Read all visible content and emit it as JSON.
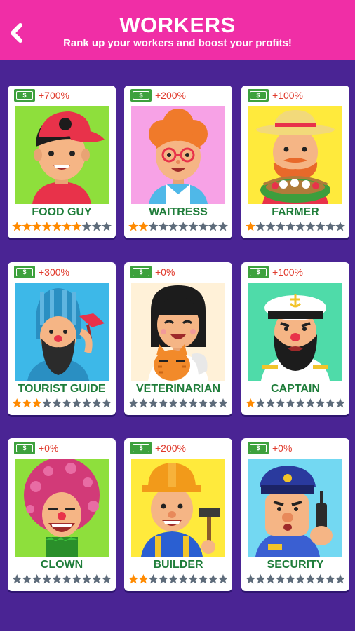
{
  "header": {
    "title": "WORKERS",
    "subtitle": "Rank up your workers and boost your profits!",
    "back_icon": "chevron-left-icon"
  },
  "money_badge": {
    "symbol": "$",
    "icon": "money-icon",
    "color": "#3da13d"
  },
  "colors": {
    "header": "#f02ea6",
    "background": "#4a2494",
    "star_filled": "#ff8a00",
    "star_empty": "#5d6b7a",
    "boost_text": "#e03a2c",
    "name_text": "#1f7d3a"
  },
  "workers": [
    {
      "name": "FOOD GUY",
      "boost": "+700%",
      "stars": 7,
      "max_stars": 10,
      "portrait_bg": "#8edf3c"
    },
    {
      "name": "WAITRESS",
      "boost": "+200%",
      "stars": 2,
      "max_stars": 10,
      "portrait_bg": "#f7a2e6"
    },
    {
      "name": "FARMER",
      "boost": "+100%",
      "stars": 1,
      "max_stars": 10,
      "portrait_bg": "#ffea3c"
    },
    {
      "name": "TOURIST GUIDE",
      "boost": "+300%",
      "stars": 3,
      "max_stars": 10,
      "portrait_bg": "#3db8e8"
    },
    {
      "name": "VETERINARIAN",
      "boost": "+0%",
      "stars": 0,
      "max_stars": 10,
      "portrait_bg": "#fff1d8"
    },
    {
      "name": "CAPTAIN",
      "boost": "+100%",
      "stars": 1,
      "max_stars": 10,
      "portrait_bg": "#4fdba9"
    },
    {
      "name": "CLOWN",
      "boost": "+0%",
      "stars": 0,
      "max_stars": 10,
      "portrait_bg": "#8edf3c"
    },
    {
      "name": "BUILDER",
      "boost": "+200%",
      "stars": 2,
      "max_stars": 10,
      "portrait_bg": "#ffea3c"
    },
    {
      "name": "SECURITY",
      "boost": "+0%",
      "stars": 0,
      "max_stars": 10,
      "portrait_bg": "#73d8f2"
    }
  ]
}
